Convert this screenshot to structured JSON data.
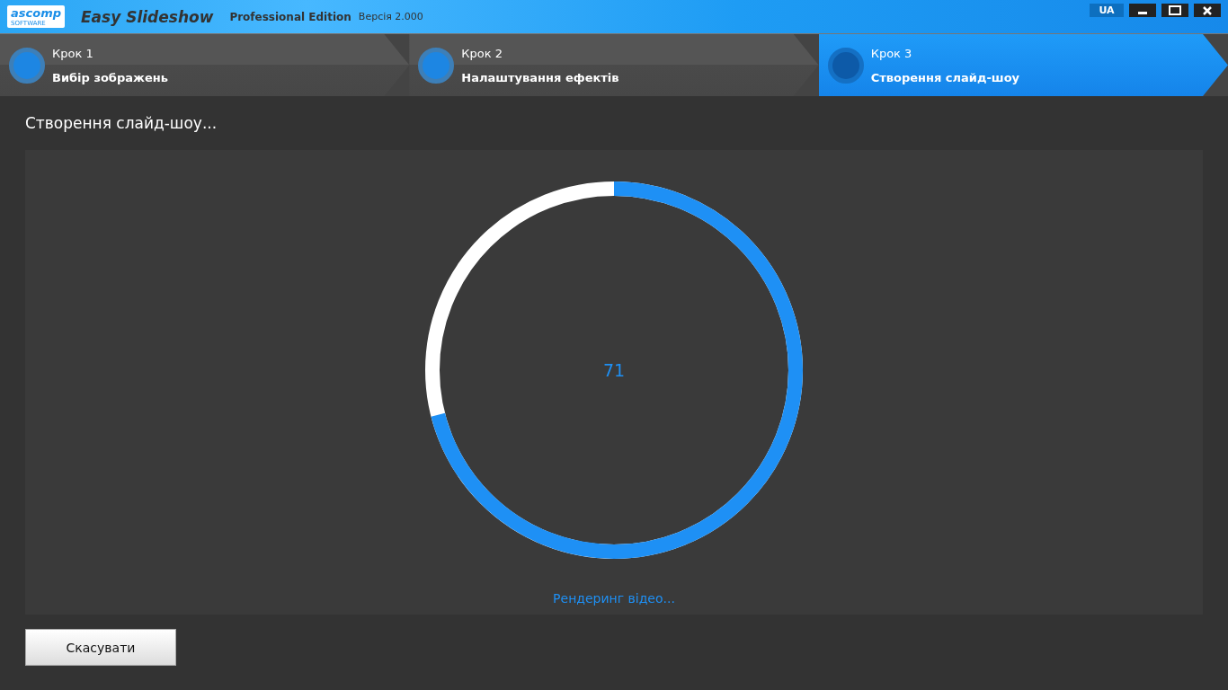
{
  "window": {
    "logo": {
      "main": "ascomp",
      "sub": "SOFTWARE"
    },
    "title": "Easy Slideshow",
    "edition": "Professional Edition",
    "version": "Версія 2.000",
    "language": "UA"
  },
  "steps": [
    {
      "number": "Крок 1",
      "label": "Вибір зображень",
      "selected": false
    },
    {
      "number": "Крок 2",
      "label": "Налаштування ефектів",
      "selected": false
    },
    {
      "number": "Крок 3",
      "label": "Створення слайд-шоу",
      "selected": true
    }
  ],
  "heading": "Створення слайд-шоу...",
  "progress": {
    "level": 0.71,
    "value": "71",
    "status": "Рендеринг відео..."
  },
  "buttons": [
    "Скасувати"
  ]
}
